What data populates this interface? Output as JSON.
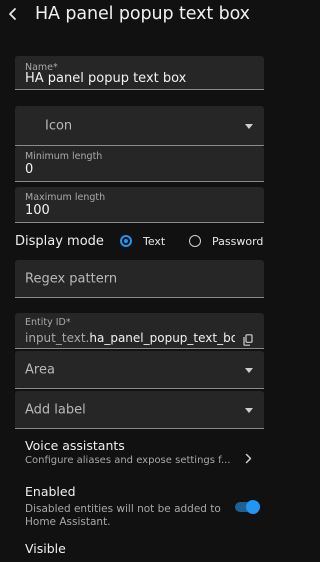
{
  "header": {
    "title": "HA panel popup text box"
  },
  "form": {
    "name": {
      "label": "Name*",
      "value": "HA panel popup text box"
    },
    "icon": {
      "placeholder": "Icon"
    },
    "min_length": {
      "label": "Minimum length",
      "value": "0"
    },
    "max_length": {
      "label": "Maximum length",
      "value": "100"
    },
    "display_mode": {
      "label": "Display mode",
      "options": [
        {
          "label": "Text",
          "selected": true
        },
        {
          "label": "Password",
          "selected": false
        }
      ]
    },
    "regex": {
      "placeholder": "Regex pattern"
    },
    "entity_id": {
      "label": "Entity ID*",
      "prefix": "input_text.",
      "value": "ha_panel_popup_text_bo"
    },
    "area": {
      "placeholder": "Area"
    },
    "label": {
      "placeholder": "Add label"
    }
  },
  "voice_assistants": {
    "title": "Voice assistants",
    "subtitle": "Configure aliases and expose settings f..."
  },
  "enabled": {
    "title": "Enabled",
    "description": "Disabled entities will not be added to Home Assistant.",
    "on": true
  },
  "visible": {
    "title": "Visible"
  },
  "colors": {
    "accent": "#2196f3",
    "background": "#111111",
    "field": "#262626"
  },
  "icons": {
    "back": "chevron-left-icon",
    "dropdown": "caret-down-icon",
    "copy": "copy-icon",
    "navigate": "chevron-right-icon"
  }
}
